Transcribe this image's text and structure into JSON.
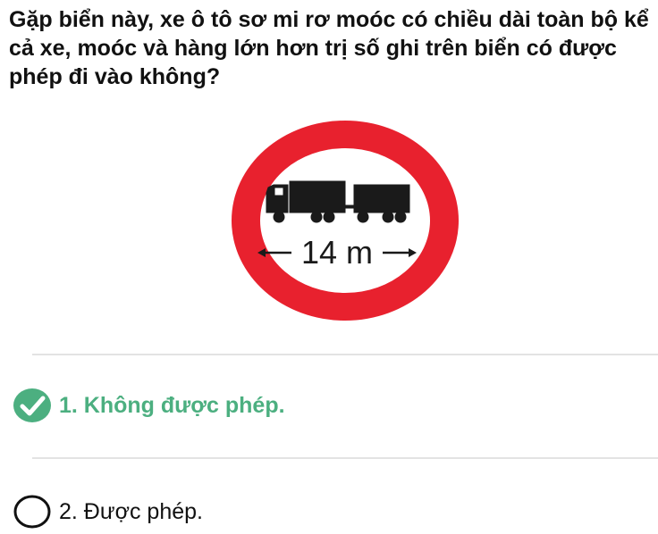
{
  "question": {
    "text": "Gặp biển này, xe ô tô sơ mi rơ moóc có chiều dài toàn bộ kể cả xe, moóc và hàng lớn hơn trị số ghi trên biển có được phép đi vào không?"
  },
  "sign": {
    "icon": "vehicle-length-limit-sign-icon",
    "text": "14 m",
    "ring_color": "#e8212e",
    "symbol_color": "#1a1a1a"
  },
  "answers": [
    {
      "label": "1. Không được phép.",
      "state": "correct",
      "icon": "check-circle-icon",
      "color": "#4caf80"
    },
    {
      "label": "2. Được phép.",
      "state": "unselected",
      "icon": "empty-circle-icon",
      "color": "#111111"
    }
  ]
}
